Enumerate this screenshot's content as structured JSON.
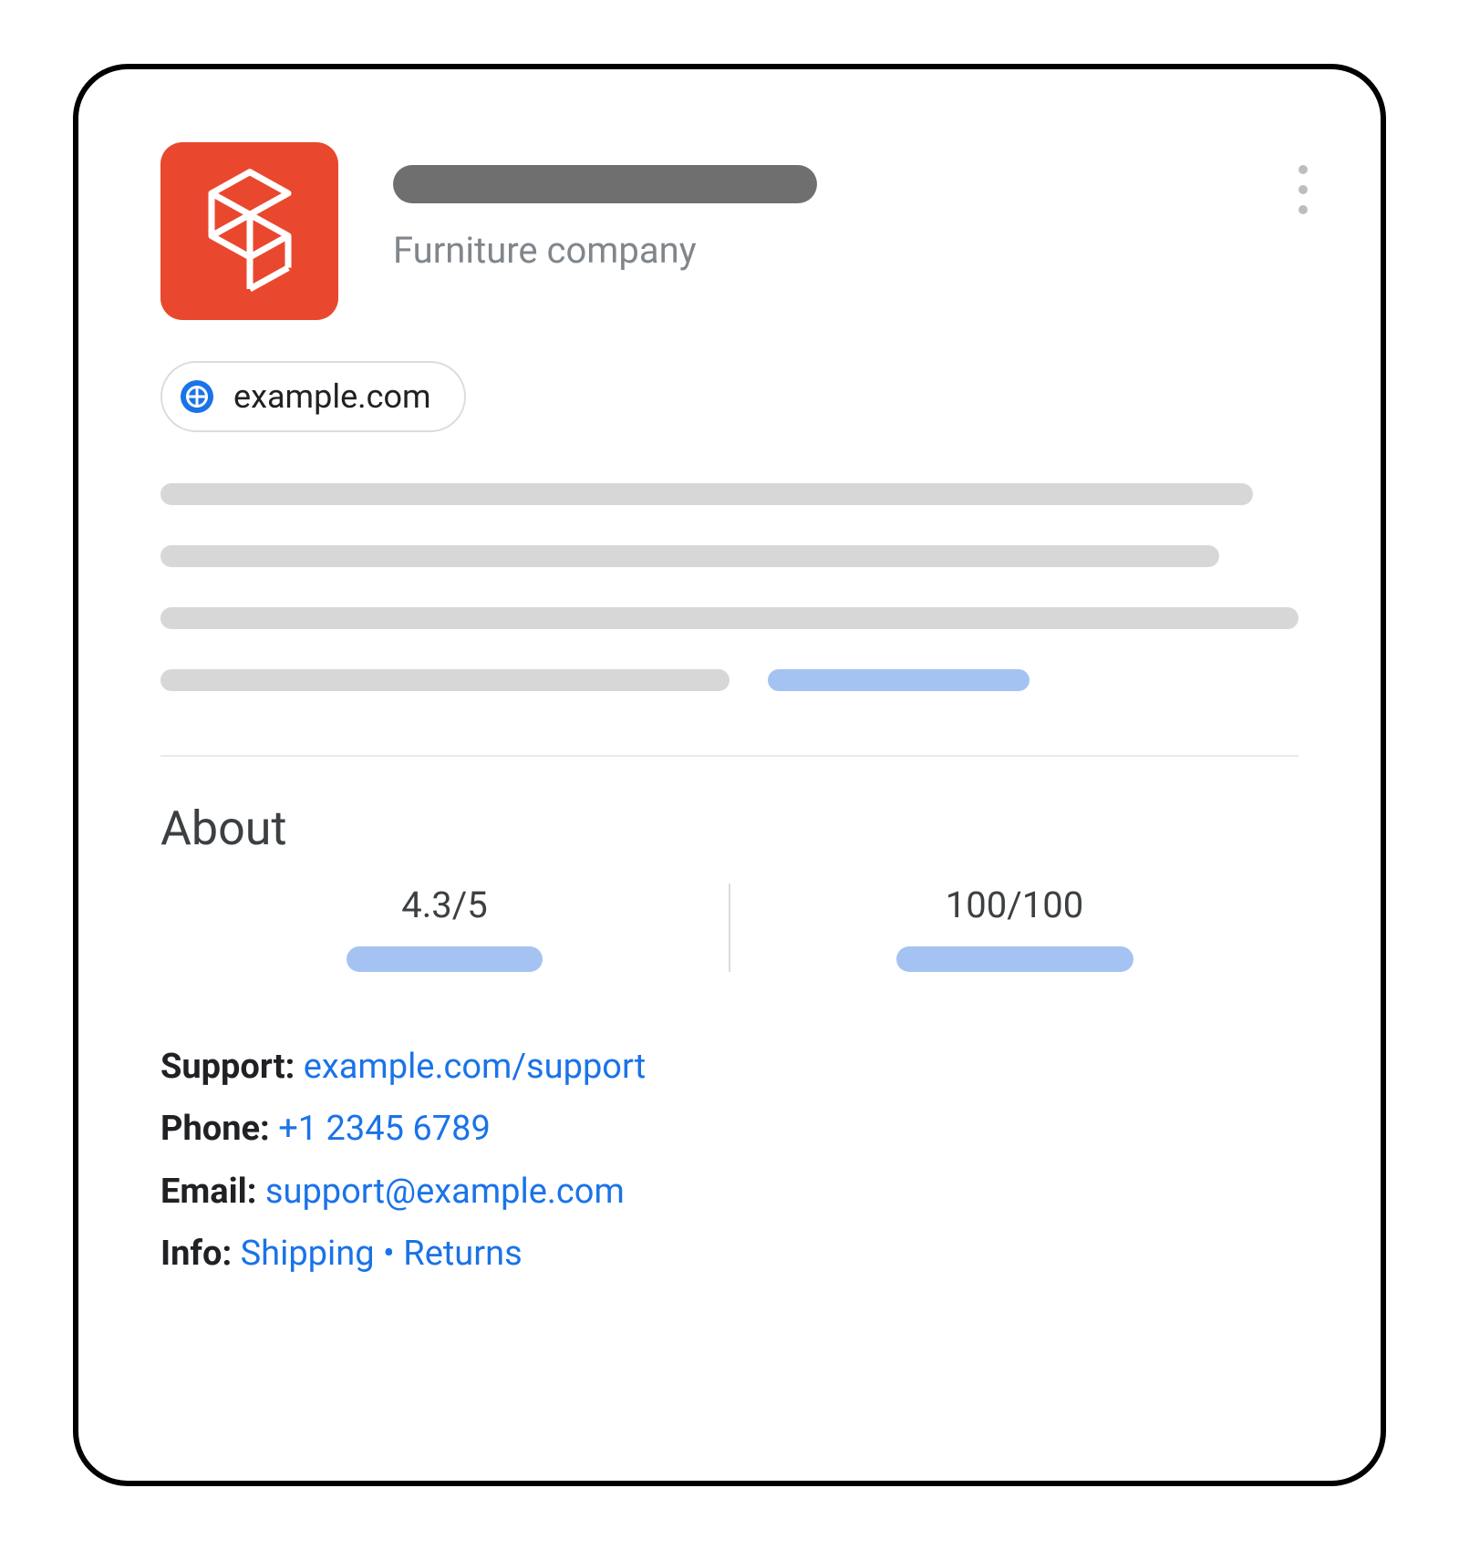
{
  "header": {
    "subtitle": "Furniture company",
    "website": "example.com"
  },
  "about": {
    "heading": "About",
    "rating": "4.3/5",
    "score": "100/100"
  },
  "contact": {
    "support_label": "Support:",
    "support_link": "example.com/support",
    "phone_label": "Phone:",
    "phone_value": "+1 2345 6789",
    "email_label": "Email:",
    "email_value": "support@example.com",
    "info_label": "Info:",
    "info_shipping": "Shipping",
    "info_separator": "•",
    "info_returns": "Returns"
  }
}
